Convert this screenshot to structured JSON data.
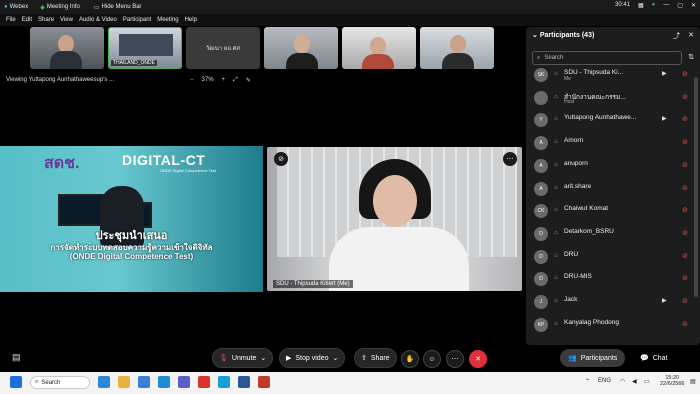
{
  "titlebar": {
    "app": "Webex",
    "meeting_info": "Meeting Info",
    "hide_menu": "Hide Menu Bar",
    "timer": "30:41"
  },
  "menu": [
    "File",
    "Edit",
    "Share",
    "View",
    "Audio & Video",
    "Participant",
    "Meeting",
    "Help"
  ],
  "thumbnails": [
    {
      "label": ""
    },
    {
      "label": "THAILAND_ONDE"
    },
    {
      "label": "วัฒนา ผอ.ศส"
    },
    {
      "label": ""
    },
    {
      "label": ""
    },
    {
      "label": ""
    }
  ],
  "viewing": "Viewing Yuttapong Aunhathaweesup's ...",
  "zoom": {
    "minus": "−",
    "level": "37%",
    "plus": "+"
  },
  "share": {
    "logo1": "สดช.",
    "logo2": "DIGITAL-CT",
    "logo2_sub": "ONDE Digital Competence Test",
    "line1": "ประชุมนำเสนอ",
    "line2": "การจัดทำระบบทดสอบความรู้ความเข้าใจดิจิทัล",
    "line3": "(ONDE Digital Competence Test)"
  },
  "speaker": {
    "name": "SDU - Thipsuda Kitlert (Me)"
  },
  "controls": {
    "unmute": "Unmute",
    "stop_video": "Stop video",
    "share": "Share"
  },
  "panel": {
    "title": "Participants (43)",
    "search_placeholder": "Search",
    "participants": [
      {
        "initials": "SK",
        "name": "SDU - Thipsuda Ki...",
        "role": "Me",
        "cam": true,
        "muted": true
      },
      {
        "initials": "",
        "name": "สำนักงานคณะกรรม...",
        "role": "Host",
        "cam": false,
        "muted": true
      },
      {
        "initials": "Y",
        "name": "Yuttapong Aunhathawe...",
        "role": "",
        "cam": true,
        "muted": true
      },
      {
        "initials": "A",
        "name": "Amorn",
        "role": "",
        "cam": false,
        "muted": true
      },
      {
        "initials": "A",
        "name": "anuporn",
        "role": "",
        "cam": false,
        "muted": true
      },
      {
        "initials": "A",
        "name": "arit.share",
        "role": "",
        "cam": false,
        "muted": true
      },
      {
        "initials": "CK",
        "name": "Chaiwut Komat",
        "role": "",
        "cam": false,
        "muted": true
      },
      {
        "initials": "D",
        "name": "Detarkom_BSRU",
        "role": "",
        "cam": false,
        "muted": true
      },
      {
        "initials": "D",
        "name": "DRU",
        "role": "",
        "cam": false,
        "muted": true
      },
      {
        "initials": "D",
        "name": "DRU-MIS",
        "role": "",
        "cam": false,
        "muted": true
      },
      {
        "initials": "J",
        "name": "Jack",
        "role": "",
        "cam": true,
        "muted": true
      },
      {
        "initials": "KP",
        "name": "Kanyalag Phodong",
        "role": "",
        "cam": false,
        "muted": true
      }
    ],
    "participants_button": "Participants",
    "chat_button": "Chat"
  },
  "taskbar": {
    "search": "Search",
    "lang": "ENG",
    "time": "15:20",
    "date": "22/6/2566"
  }
}
